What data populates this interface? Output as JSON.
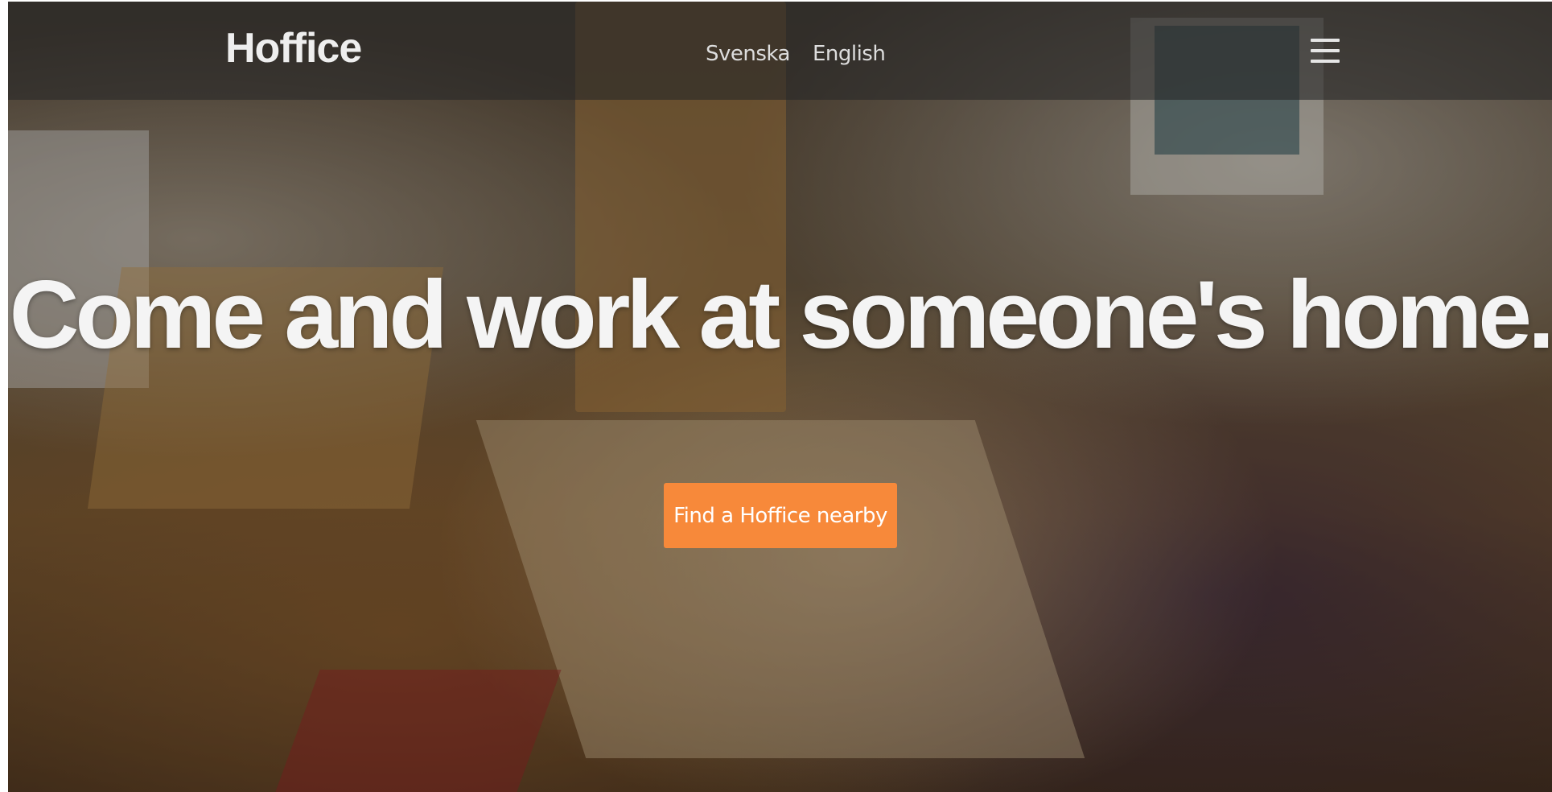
{
  "header": {
    "logo": "Hoffice",
    "languages": [
      {
        "label": "Svenska"
      },
      {
        "label": "English"
      }
    ],
    "menu_icon": "hamburger-menu-icon"
  },
  "hero": {
    "headline": "Come and work at someone's home.",
    "cta_label": "Find a Hoffice nearby",
    "cta_color": "#f7893a",
    "background": "photo of people working in a home living room"
  }
}
